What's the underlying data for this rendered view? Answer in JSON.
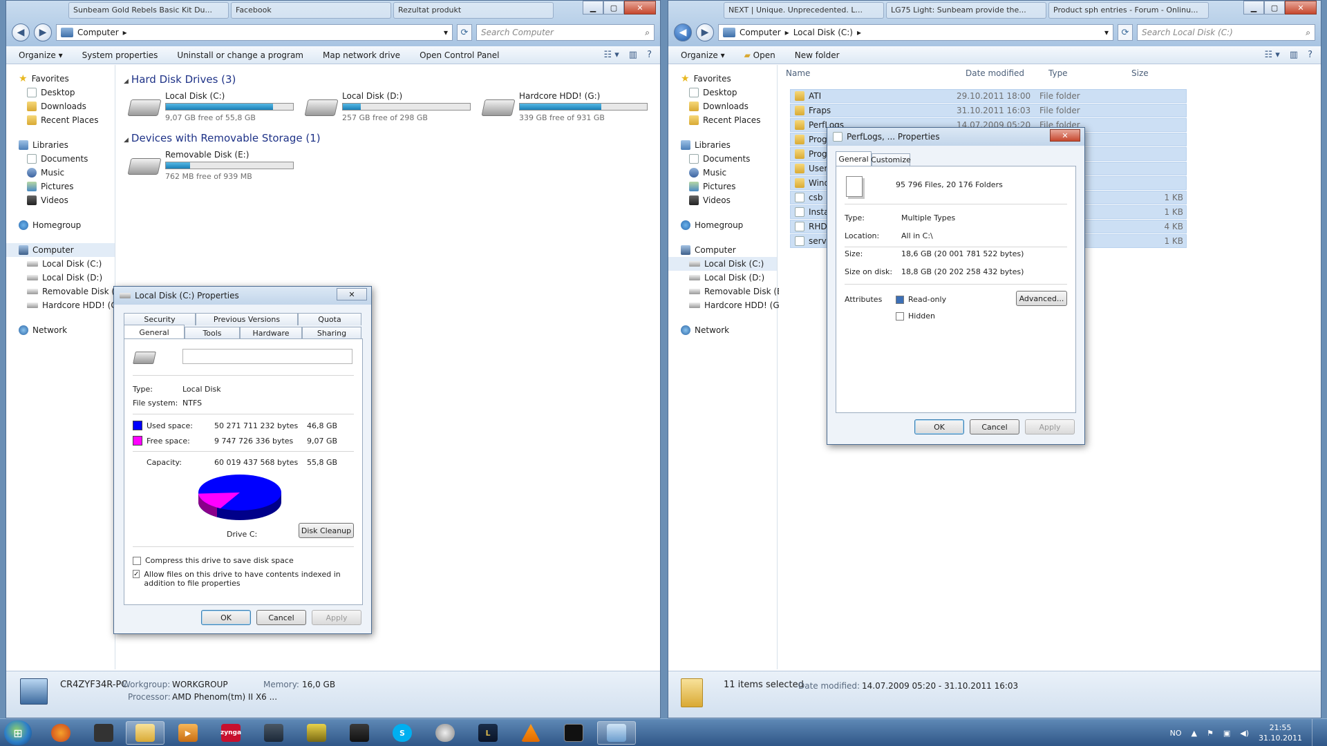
{
  "left_window": {
    "tabs": [
      "Sunbeam Gold Rebels Basic Kit Du...",
      "Facebook",
      "Rezultat produkt"
    ],
    "address": [
      "Computer"
    ],
    "search_placeholder": "Search Computer",
    "commands": [
      "Organize",
      "System properties",
      "Uninstall or change a program",
      "Map network drive",
      "Open Control Panel"
    ],
    "sections": {
      "hdd_title": "Hard Disk Drives (3)",
      "removable_title": "Devices with Removable Storage (1)"
    },
    "drives": [
      {
        "name": "Local Disk (C:)",
        "free": "9,07 GB free of 55,8 GB",
        "used_fraction": 0.84
      },
      {
        "name": "Local Disk (D:)",
        "free": "257 GB free of 298 GB",
        "used_fraction": 0.14
      },
      {
        "name": "Hardcore HDD! (G:)",
        "free": "339 GB free of 931 GB",
        "used_fraction": 0.64
      }
    ],
    "removable": [
      {
        "name": "Removable Disk (E:)",
        "free": "762 MB free of 939 MB",
        "used_fraction": 0.19
      }
    ],
    "details": {
      "pc_name": "CR4ZYF34R-PC",
      "workgroup_label": "Workgroup:",
      "workgroup": "WORKGROUP",
      "memory_label": "Memory:",
      "memory": "16,0 GB",
      "processor_label": "Processor:",
      "processor": "AMD Phenom(tm) II X6 ..."
    }
  },
  "nav": {
    "favorites": "Favorites",
    "fav_items": [
      "Desktop",
      "Downloads",
      "Recent Places"
    ],
    "libraries": "Libraries",
    "lib_items": [
      "Documents",
      "Music",
      "Pictures",
      "Videos"
    ],
    "homegroup": "Homegroup",
    "computer": "Computer",
    "comp_items": [
      "Local Disk (C:)",
      "Local Disk (D:)",
      "Removable Disk (E:)",
      "Hardcore HDD! (G:)"
    ],
    "network": "Network"
  },
  "right_window": {
    "tabs": [
      "NEXT | Unique. Unprecedented. L...",
      "LG75 Light: Sunbeam provide the...",
      "Product sph entries - Forum - Onlinu..."
    ],
    "address": [
      "Computer",
      "Local Disk (C:)"
    ],
    "search_placeholder": "Search Local Disk (C:)",
    "commands": [
      "Organize",
      "Open",
      "New folder"
    ],
    "columns": [
      "Name",
      "Date modified",
      "Type",
      "Size"
    ],
    "files": [
      {
        "name": "ATI",
        "date": "29.10.2011 18:00",
        "type": "File folder",
        "size": "",
        "icon": "folder"
      },
      {
        "name": "Fraps",
        "date": "31.10.2011 16:03",
        "type": "File folder",
        "size": "",
        "icon": "folder"
      },
      {
        "name": "PerfLogs",
        "date": "14.07.2009 05:20",
        "type": "File folder",
        "size": "",
        "icon": "folder"
      },
      {
        "name": "Progr",
        "date": "",
        "type": "",
        "size": "",
        "icon": "folder"
      },
      {
        "name": "Progr",
        "date": "",
        "type": "",
        "size": "",
        "icon": "folder"
      },
      {
        "name": "Users",
        "date": "",
        "type": "",
        "size": "",
        "icon": "folder"
      },
      {
        "name": "Wind",
        "date": "",
        "type": "",
        "size": "",
        "icon": "folder"
      },
      {
        "name": "csb",
        "date": "",
        "type": "ument",
        "size": "1 KB",
        "icon": "doc"
      },
      {
        "name": "Instal",
        "date": "",
        "type": "ument",
        "size": "1 KB",
        "icon": "doc"
      },
      {
        "name": "RHDS",
        "date": "",
        "type": "ument",
        "size": "4 KB",
        "icon": "doc"
      },
      {
        "name": "servic",
        "date": "",
        "type": "ument",
        "size": "1 KB",
        "icon": "doc"
      }
    ],
    "status": {
      "selected": "11 items selected",
      "date_label": "Date modified:",
      "date_range": "14.07.2009 05:20 - 31.10.2011 16:03"
    }
  },
  "disk_props": {
    "title": "Local Disk (C:) Properties",
    "tabs_top": [
      "Security",
      "Previous Versions",
      "Quota"
    ],
    "tabs_bottom": [
      "General",
      "Tools",
      "Hardware",
      "Sharing"
    ],
    "label_value": "",
    "type_label": "Type:",
    "type": "Local Disk",
    "fs_label": "File system:",
    "fs": "NTFS",
    "used_label": "Used space:",
    "used_bytes": "50 271 711 232 bytes",
    "used_gb": "46,8 GB",
    "free_label": "Free space:",
    "free_bytes": "9 747 726 336 bytes",
    "free_gb": "9,07 GB",
    "cap_label": "Capacity:",
    "cap_bytes": "60 019 437 568 bytes",
    "cap_gb": "55,8 GB",
    "drive_label": "Drive C:",
    "cleanup": "Disk Cleanup",
    "compress": "Compress this drive to save disk space",
    "index": "Allow files on this drive to have contents indexed in addition to file properties",
    "index_checked": true,
    "compress_checked": false,
    "used_color": "#0000ff",
    "free_color": "#ff00ff",
    "used_fraction": 0.8376,
    "ok": "OK",
    "cancel": "Cancel",
    "apply": "Apply"
  },
  "perf_props": {
    "title": "PerfLogs, ... Properties",
    "tabs": [
      "General",
      "Customize"
    ],
    "summary": "95 796 Files, 20 176 Folders",
    "type_label": "Type:",
    "type": "Multiple Types",
    "loc_label": "Location:",
    "location": "All in C:\\",
    "size_label": "Size:",
    "size": "18,6 GB (20 001 781 522 bytes)",
    "sod_label": "Size on disk:",
    "size_on_disk": "18,8 GB (20 202 258 432 bytes)",
    "attr_label": "Attributes",
    "readonly": "Read-only",
    "hidden": "Hidden",
    "advanced": "Advanced...",
    "ok": "OK",
    "cancel": "Cancel",
    "apply": "Apply"
  },
  "taskbar": {
    "lang": "NO",
    "time": "21:55",
    "date": "31.10.2011",
    "apps": [
      "firefox",
      "mouse-utility",
      "explorer",
      "media",
      "zynga",
      "steam",
      "game",
      "msi",
      "skype",
      "webcam",
      "league",
      "vlc",
      "terminal",
      "screenshot"
    ],
    "zynga_label": "zynga"
  },
  "colors": {
    "accent": "#1e3287",
    "selection": "#ccdff4",
    "drive_bar": "#26a0da"
  }
}
